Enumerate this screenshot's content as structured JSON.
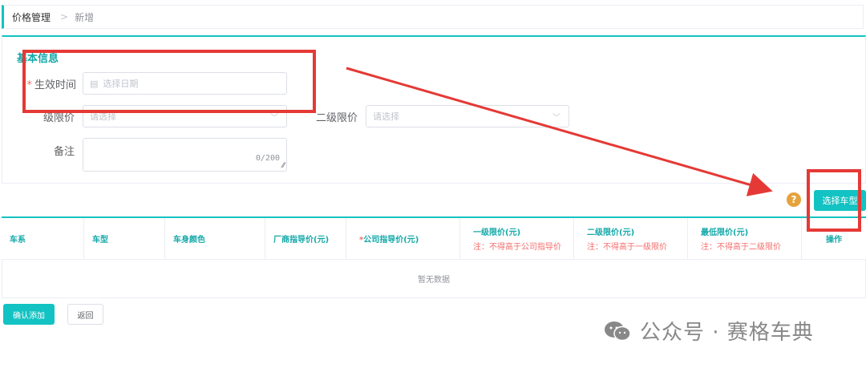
{
  "breadcrumb": {
    "root": "价格管理",
    "separator": ">",
    "current": "新增"
  },
  "form": {
    "section_title": "基本信息",
    "effective_time": {
      "label": "生效时间",
      "placeholder": "选择日期"
    },
    "level1_limit": {
      "label": "级限价",
      "placeholder": "请选择"
    },
    "level2_limit": {
      "label": "二级限价",
      "placeholder": "请选择"
    },
    "remark": {
      "label": "备注",
      "counter": "0/200"
    }
  },
  "toolbar": {
    "help_icon": "?",
    "select_model_label": "选择车型"
  },
  "table": {
    "columns": [
      {
        "title": "车系",
        "note": ""
      },
      {
        "title": "车型",
        "note": ""
      },
      {
        "title": "车身颜色",
        "note": ""
      },
      {
        "title": "厂商指导价(元)",
        "note": ""
      },
      {
        "title": "公司指导价(元)",
        "note": "",
        "required": "*"
      },
      {
        "title": "一级限价(元)",
        "note": "注：不得高于公司指导价"
      },
      {
        "title": "二级限价(元)",
        "note": "注：不得高于一级限价"
      },
      {
        "title": "最低限价(元)",
        "note": "注：不得高于二级限价"
      },
      {
        "title": "操作",
        "note": ""
      }
    ],
    "empty_text": "暂无数据"
  },
  "footer": {
    "confirm_label": "确认添加",
    "back_label": "返回"
  },
  "watermark": {
    "text": "公众号 · 赛格车典"
  },
  "colors": {
    "accent": "#13c2c2",
    "annotation": "#e53935",
    "required": "#f56c6c",
    "help": "#e6a23c"
  },
  "icons": {
    "calendar": "calendar-icon",
    "chevron": "chevron-down-icon",
    "help": "question-icon",
    "wechat": "wechat-icon"
  }
}
